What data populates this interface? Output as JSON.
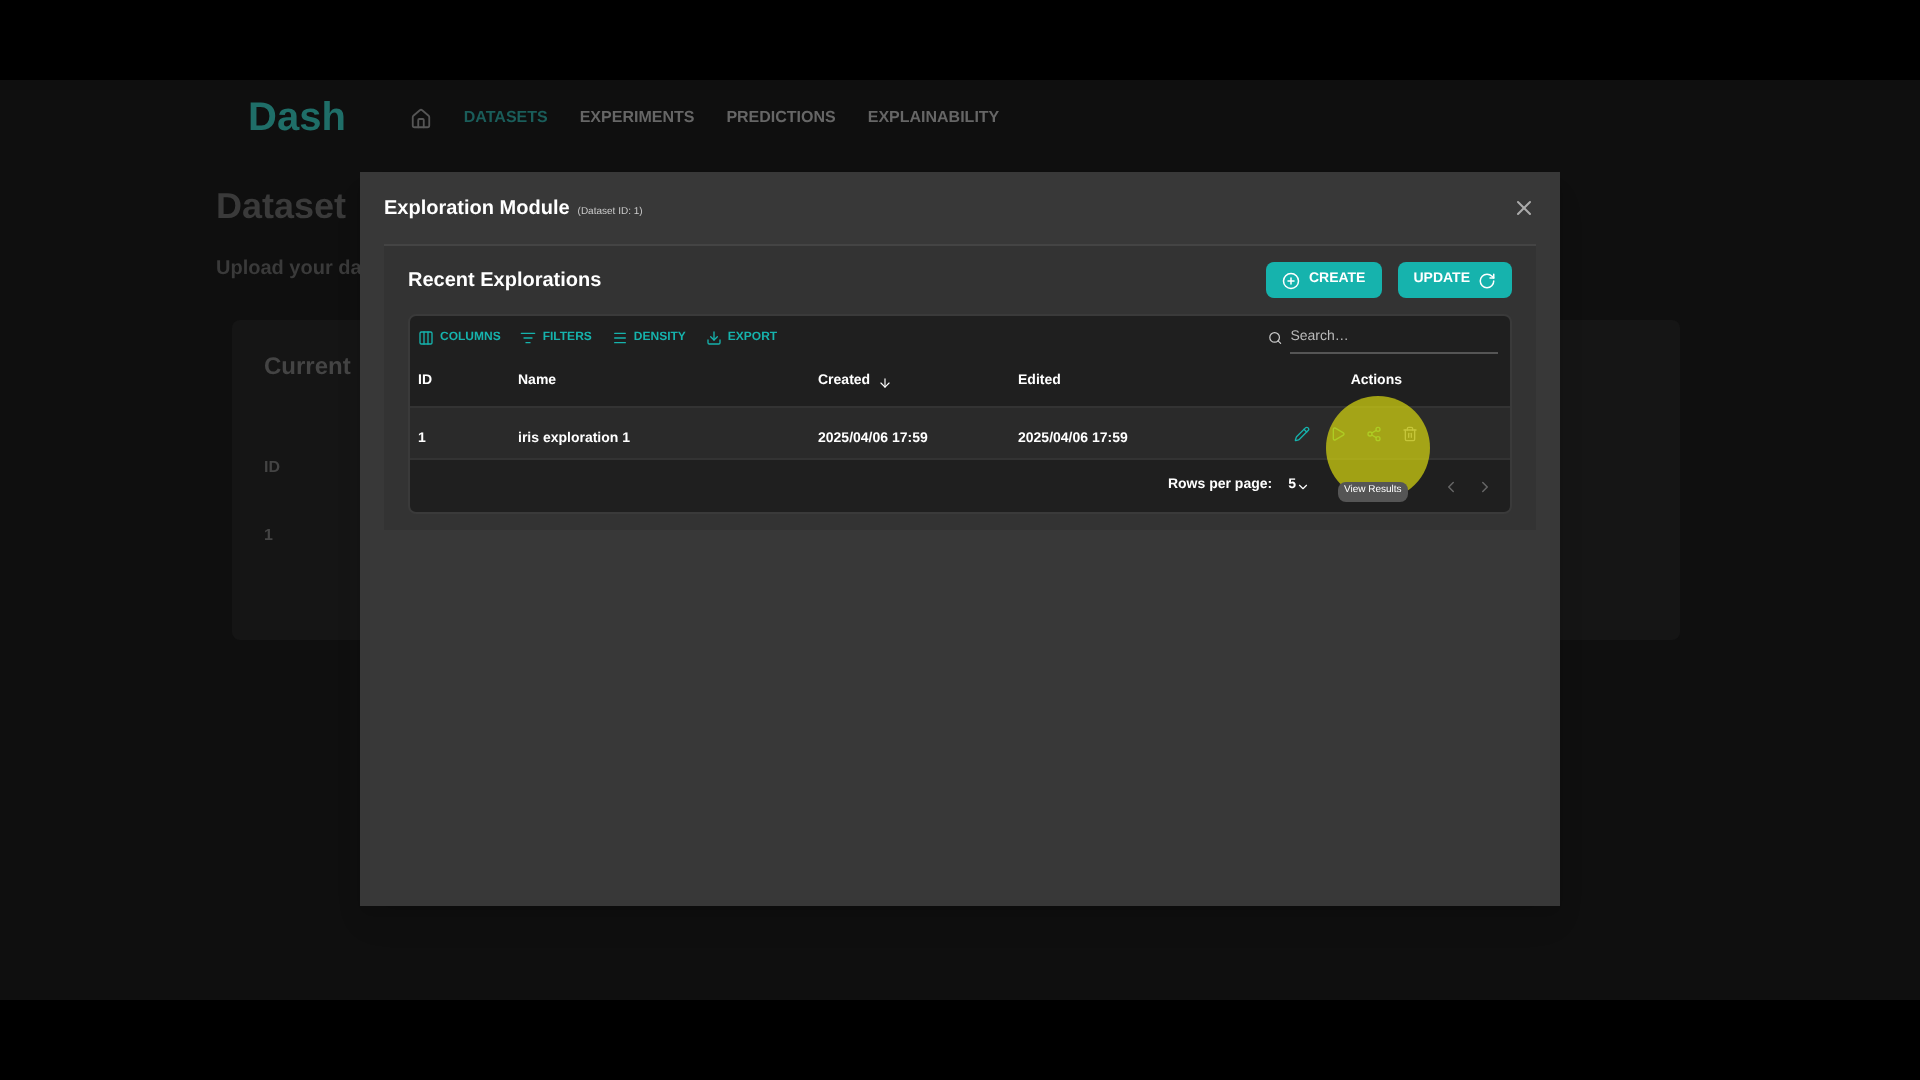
{
  "app": {
    "logo": "Dash",
    "nav": [
      {
        "label": "DATASETS",
        "selected": true
      },
      {
        "label": "EXPERIMENTS",
        "selected": false
      },
      {
        "label": "PREDICTIONS",
        "selected": false
      },
      {
        "label": "EXPLAINABILITY",
        "selected": false
      }
    ],
    "page_title": "Dataset",
    "page_subtitle": "Upload your da",
    "card_title": "Current",
    "card_column": "ID",
    "card_cell": "1"
  },
  "modal": {
    "title": "Exploration Module",
    "subtitle": "(Dataset ID: 1)",
    "section_title": "Recent Explorations",
    "buttons": [
      {
        "label": "CREATE",
        "kind": "create"
      },
      {
        "label": "UPDATE",
        "kind": "update"
      }
    ],
    "toolbar": [
      {
        "label": "COLUMNS",
        "kind": "columns"
      },
      {
        "label": "FILTERS",
        "kind": "filters"
      },
      {
        "label": "DENSITY",
        "kind": "density"
      },
      {
        "label": "EXPORT",
        "kind": "export"
      }
    ],
    "search": {
      "placeholder": "Search…"
    },
    "columns": [
      {
        "label": "ID",
        "sorted": false
      },
      {
        "label": "Name",
        "sorted": false
      },
      {
        "label": "Created",
        "sorted": true
      },
      {
        "label": "Edited",
        "sorted": false
      },
      {
        "label": "Actions",
        "sorted": false
      }
    ],
    "rows": [
      {
        "cells": [
          "1",
          "iris exploration 1",
          "2025/04/06 17:59",
          "2025/04/06 17:59"
        ]
      }
    ],
    "footer": {
      "rows_label": "Rows per page:",
      "rows_value": "5"
    },
    "tooltip": "View Results"
  }
}
